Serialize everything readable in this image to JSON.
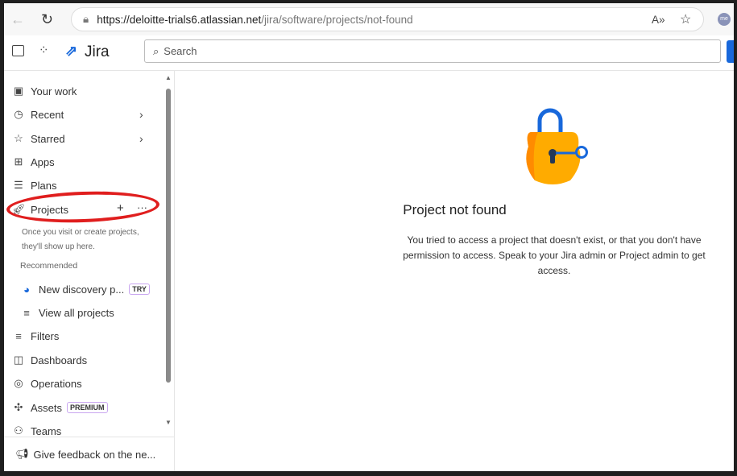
{
  "browser": {
    "url_host": "https://deloitte-trials6.atlassian.net",
    "url_path": "/jira/software/projects/not-found",
    "avatar": "me"
  },
  "topbar": {
    "app_name": "Jira",
    "search_placeholder": "Search"
  },
  "sidebar": {
    "items": [
      {
        "label": "Your work",
        "icon": "your-work-icon"
      },
      {
        "label": "Recent",
        "icon": "clock-icon"
      },
      {
        "label": "Starred",
        "icon": "star-icon"
      },
      {
        "label": "Apps",
        "icon": "apps-icon"
      },
      {
        "label": "Plans",
        "icon": "plans-icon"
      },
      {
        "label": "Projects",
        "icon": "rocket-icon"
      }
    ],
    "projects_hint_1": "Once you visit or create projects,",
    "projects_hint_2": "they'll show up here.",
    "recommended": "Recommended",
    "discovery": "New discovery p...",
    "try_badge": "TRY",
    "view_all": "View all projects",
    "more": [
      {
        "label": "Filters"
      },
      {
        "label": "Dashboards"
      },
      {
        "label": "Operations"
      },
      {
        "label": "Assets"
      },
      {
        "label": "Teams"
      }
    ],
    "premium_badge": "PREMIUM",
    "feedback": "Give feedback on the ne..."
  },
  "main": {
    "title": "Project not found",
    "description": "You tried to access a project that doesn't exist, or that you don't have permission to access. Speak to your Jira admin or Project admin to get access."
  },
  "colors": {
    "accent": "#1868db",
    "lock": "#ffab00",
    "annotation": "#e01e1e"
  }
}
